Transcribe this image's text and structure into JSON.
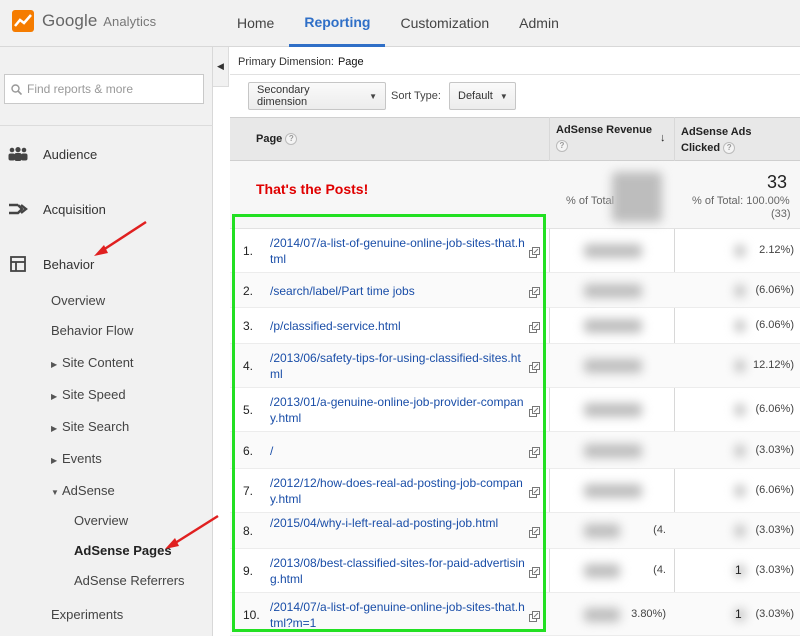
{
  "header": {
    "brand": "Google",
    "brand_sub": "Analytics",
    "nav": [
      "Home",
      "Reporting",
      "Customization",
      "Admin"
    ]
  },
  "sidebar": {
    "search_placeholder": "Find reports & more",
    "sections": [
      "Audience",
      "Acquisition",
      "Behavior"
    ],
    "behavior_items": [
      "Overview",
      "Behavior Flow",
      "Site Content",
      "Site Speed",
      "Site Search",
      "Events",
      "AdSense"
    ],
    "adsense_items": [
      "Overview",
      "AdSense Pages",
      "AdSense Referrers"
    ],
    "experiments": "Experiments"
  },
  "report": {
    "primary_label": "Primary Dimension:",
    "primary_value": "Page",
    "secondary_dimension": "Secondary dimension",
    "sort_label": "Sort Type:",
    "sort_value": "Default",
    "columns": [
      "Page",
      "AdSense Revenue",
      "AdSense Ads",
      "Clicked"
    ],
    "totals_title": "That's the Posts!",
    "revenue_total_label": "% of Total",
    "clicks_total": "33",
    "clicks_total_label1": "% of Total: 100.00%",
    "clicks_total_label2": "(33)"
  },
  "rows": [
    {
      "n": "1.",
      "url": "/2014/07/a-list-of-genuine-online-job-sites-that.html",
      "rev_pct": "",
      "clk_pct": "2.12%)",
      "clk_val": ""
    },
    {
      "n": "2.",
      "url": "/search/label/Part time jobs",
      "rev_pct": "",
      "clk_pct": "(6.06%)",
      "clk_val": ""
    },
    {
      "n": "3.",
      "url": "/p/classified-service.html",
      "rev_pct": "",
      "clk_pct": "(6.06%)",
      "clk_val": ""
    },
    {
      "n": "4.",
      "url": "/2013/06/safety-tips-for-using-classified-sites.html",
      "rev_pct": "",
      "clk_pct": "12.12%)",
      "clk_val": ""
    },
    {
      "n": "5.",
      "url": "/2013/01/a-genuine-online-job-provider-company.html",
      "rev_pct": "",
      "clk_pct": "(6.06%)",
      "clk_val": ""
    },
    {
      "n": "6.",
      "url": "/",
      "rev_pct": "",
      "clk_pct": "(3.03%)",
      "clk_val": ""
    },
    {
      "n": "7.",
      "url": "/2012/12/how-does-real-ad-posting-job-company.html",
      "rev_pct": "",
      "clk_pct": "(6.06%)",
      "clk_val": ""
    },
    {
      "n": "8.",
      "url": "/2015/04/why-i-left-real-ad-posting-job.html",
      "rev_pct": "(4.",
      "clk_pct": "(3.03%)",
      "clk_val": ""
    },
    {
      "n": "9.",
      "url": "/2013/08/best-classified-sites-for-paid-advertising.html",
      "rev_pct": "(4.",
      "clk_pct": "(3.03%)",
      "clk_val": "1"
    },
    {
      "n": "10.",
      "url": "/2014/07/a-list-of-genuine-online-job-sites-that.html?m=1",
      "rev_pct": "3.80%)",
      "clk_pct": "(3.03%)",
      "clk_val": "1"
    }
  ],
  "colors": {
    "accent": "#2f6fc7",
    "link": "#1a4ea8",
    "highlight_box": "#22e022",
    "annotation_arrow": "#e02020",
    "title_red": "#e00000"
  }
}
